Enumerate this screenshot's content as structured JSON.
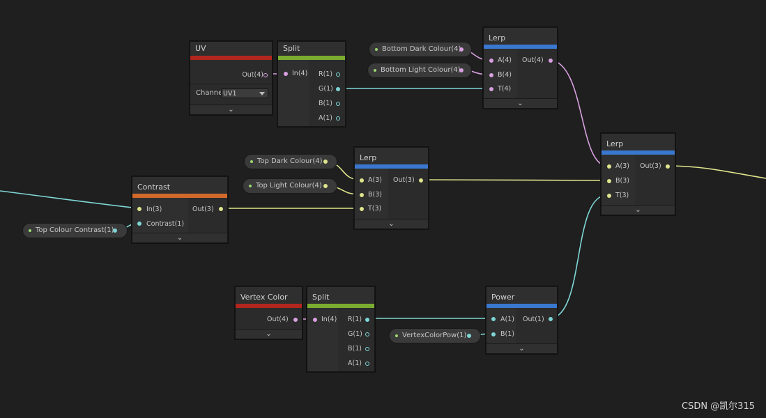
{
  "colors": {
    "background": "#1f1f1f",
    "uv_bar": "#b3261e",
    "split_bar": "#7aad2f",
    "lerp_bar": "#3a78d0",
    "contrast_bar": "#d2692a",
    "power_bar": "#3a78d0",
    "vertex_color_bar": "#b3261e",
    "wire_vector4": "#d8a0e0",
    "wire_vector3": "#dfe58c",
    "wire_vector1": "#7fd6d6"
  },
  "collapse_glyph": "⌄",
  "nodes": {
    "uv": {
      "title": "UV",
      "out": "Out(4)",
      "channel_label": "Channe",
      "channel_value": "UV1"
    },
    "split_top": {
      "title": "Split",
      "in": "In(4)",
      "outs": [
        "R(1)",
        "G(1)",
        "B(1)",
        "A(1)"
      ]
    },
    "lerp_top": {
      "title": "Lerp",
      "ins": [
        "A(4)",
        "B(4)",
        "T(4)"
      ],
      "out": "Out(4)"
    },
    "contrast": {
      "title": "Contrast",
      "ins": [
        "In(3)",
        "Contrast(1)"
      ],
      "out": "Out(3)"
    },
    "lerp_mid": {
      "title": "Lerp",
      "ins": [
        "A(3)",
        "B(3)",
        "T(3)"
      ],
      "out": "Out(3)"
    },
    "lerp_right": {
      "title": "Lerp",
      "ins": [
        "A(3)",
        "B(3)",
        "T(3)"
      ],
      "out": "Out(3)"
    },
    "vertex_color": {
      "title": "Vertex Color",
      "out": "Out(4)"
    },
    "split_bottom": {
      "title": "Split",
      "in": "In(4)",
      "outs": [
        "R(1)",
        "G(1)",
        "B(1)",
        "A(1)"
      ]
    },
    "power": {
      "title": "Power",
      "ins": [
        "A(1)",
        "B(1)"
      ],
      "out": "Out(1)"
    }
  },
  "properties": {
    "bottom_dark": "Bottom Dark Colour(4)",
    "bottom_light": "Bottom Light Colour(4)",
    "top_dark": "Top Dark Colour(4)",
    "top_light": "Top Light Colour(4)",
    "top_contrast": "Top Colour Contrast(1)",
    "vertex_pow": "VertexColorPow(1)"
  },
  "watermark": "CSDN @凯尔315"
}
